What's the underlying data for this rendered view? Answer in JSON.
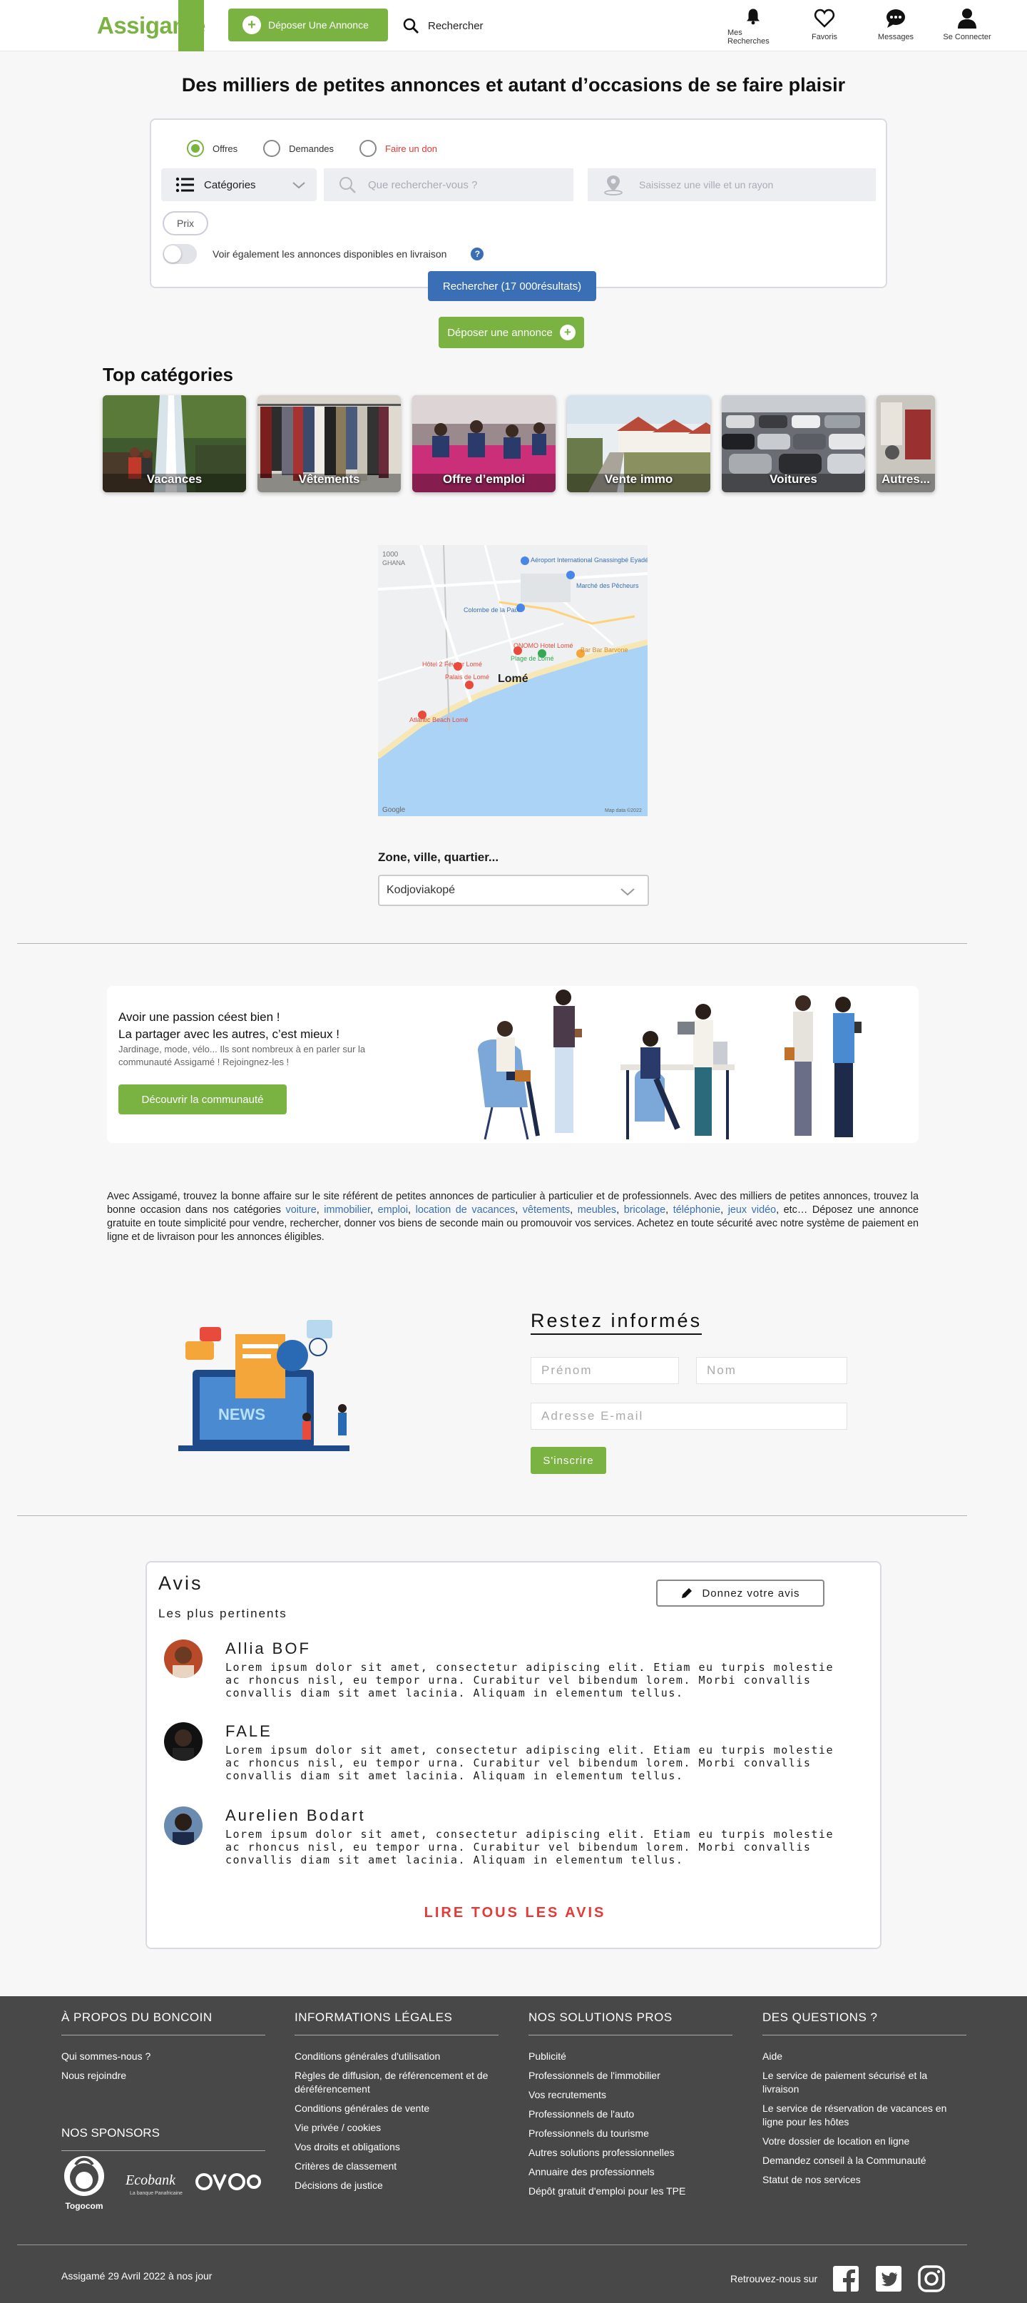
{
  "header": {
    "logo": "Assigamé",
    "deposer": "Déposer Une Annonce",
    "rechercher": "Rechercher",
    "nav": {
      "recherches": "Mes Recherches",
      "favoris": "Favoris",
      "messages": "Messages",
      "connecter": "Se Connecter"
    }
  },
  "hero": {
    "title": "Des milliers de petites annonces et autant d’occasions de se faire plaisir"
  },
  "search": {
    "radio_offres": "Offres",
    "radio_demandes": "Demandes",
    "radio_don": "Faire un don",
    "categories": "Catégories",
    "what_placeholder": "Que rechercher-vous ?",
    "where_placeholder": "Saisissez une ville et un rayon",
    "prix": "Prix",
    "livraison_label": "Voir également les annonces disponibles en livraison",
    "help": "?",
    "submit": "Rechercher (17 000résultats)",
    "deposer": "Déposer une annonce"
  },
  "top_categories": {
    "title": "Top catégories",
    "items": [
      {
        "label": "Vacances"
      },
      {
        "label": "Vêtements"
      },
      {
        "label": "Offre d’emploi"
      },
      {
        "label": "Vente immo"
      },
      {
        "label": "Voitures"
      },
      {
        "label": "Autres..."
      }
    ]
  },
  "map": {
    "city": "Lomé",
    "labels": {
      "airport": "Aéroport International Gnassingbé Eyadéma...",
      "marche": "Marché des Pêcheurs",
      "colombe": "Colombe de la Paix",
      "onomo": "ONOMO Hotel Lomé",
      "bar": "Bar Bar Barvone",
      "plage": "Plage de Lomé",
      "hotel2": "Hôtel 2 Février Lomé",
      "palais": "Palais de Lomé",
      "atlantic": "Atlantic Beach Lomé",
      "google": "Google",
      "mapdata": "Map data ©2022"
    }
  },
  "zone": {
    "label": "Zone, ville, quartier...",
    "value": "Kodjoviakopé"
  },
  "community": {
    "title": "Avoir une passion céest bien !\nLa partager avec les autres, c’est mieux !",
    "subtitle": "Jardinage, mode, vélo... Ils sont nombreux à en parler sur la communauté Assigamé ! Rejoingnez-les !",
    "button": "Découvrir la communauté"
  },
  "seo": {
    "intro": "Avec Assigamé, trouvez la bonne affaire sur le site référent de petites annonces de particulier à particulier et de professionnels. Avec des milliers de petites annonces, trouvez la bonne occasion dans nos catégories ",
    "links": [
      "voiture",
      "immobilier",
      "emploi",
      "location de vacances",
      "vêtements",
      "meubles",
      "bricolage",
      "téléphonie",
      "jeux vidéo"
    ],
    "outro": "etc… Déposez une annonce gratuite en toute simplicité pour vendre, rechercher, donner vos biens de seconde main ou promouvoir vos services. Achetez en toute sécurité avec notre système de paiement en ligne et de livraison pour les annonces éligibles."
  },
  "newsletter": {
    "title": "Restez informés",
    "prenom": "Prénom",
    "nom": "Nom",
    "email": "Adresse E-mail",
    "button": "S'inscrire"
  },
  "reviews": {
    "title": "Avis",
    "subtitle": "Les plus pertinents",
    "button": "Donnez votre avis",
    "items": [
      {
        "name": "Allia BOF",
        "text": "Lorem ipsum dolor sit amet, consectetur adipiscing elit. Etiam eu turpis molestie ac rhoncus nisl, eu tempor urna. Curabitur vel bibendum lorem. Morbi convallis convallis diam sit amet lacinia. Aliquam in elementum tellus."
      },
      {
        "name": "FALE",
        "text": "Lorem ipsum dolor sit amet, consectetur adipiscing elit. Etiam eu turpis molestie ac rhoncus nisl, eu tempor urna. Curabitur vel bibendum lorem. Morbi convallis convallis diam sit amet lacinia. Aliquam in elementum tellus."
      },
      {
        "name": "Aurelien Bodart",
        "text": "Lorem ipsum dolor sit amet, consectetur adipiscing elit. Etiam eu turpis molestie ac rhoncus nisl, eu tempor urna. Curabitur vel bibendum lorem. Morbi convallis convallis diam sit amet lacinia. Aliquam in elementum tellus."
      }
    ],
    "read_all": "LIRE TOUS LES AVIS"
  },
  "footer": {
    "col1": {
      "title": "À PROPOS DU BONCOIN",
      "items": [
        "Qui sommes-nous ?",
        "Nous rejoindre"
      ]
    },
    "col2": {
      "title": "INFORMATIONS LÉGALES",
      "items": [
        "Conditions générales d'utilisation",
        "Règles de diffusion, de référencement et de déréférencement",
        "Conditions générales de vente",
        "Vie privée / cookies",
        "Vos droits et obligations",
        "Critères de classement",
        "Décisions de justice"
      ]
    },
    "col3": {
      "title": "NOS SOLUTIONS PROS",
      "items": [
        "Publicité",
        "Professionnels de l'immobilier",
        "Vos recrutements",
        "Professionnels de l'auto",
        "Professionnels du tourisme",
        "Autres solutions professionnelles",
        "Annuaire des professionnels",
        "Dépôt gratuit d'emploi pour les TPE"
      ]
    },
    "col4": {
      "title": "DES QUESTIONS ?",
      "items": [
        "Aide",
        "Le service de paiement sécurisé et la livraison",
        "Le service de réservation de vacances en ligne pour les hôtes",
        "Votre dossier de location en ligne",
        "Demandez conseil à la Communauté",
        "Statut de nos services"
      ]
    },
    "sponsors_title": "NOS SPONSORS",
    "sponsors": {
      "togocom": "Togocom",
      "ecobank": "Ecobank",
      "ecobank_sub": "La banque Panafricaine",
      "onomo": "ONOMO"
    },
    "copyright": "Assigamé 29 Avril 2022 à nos jour",
    "follow": "Retrouvez-nous sur"
  },
  "colors": {
    "brand_green": "#7bb342",
    "brand_blue": "#3a6fb5",
    "accent_red": "#e53935",
    "footer_bg": "#484848"
  }
}
